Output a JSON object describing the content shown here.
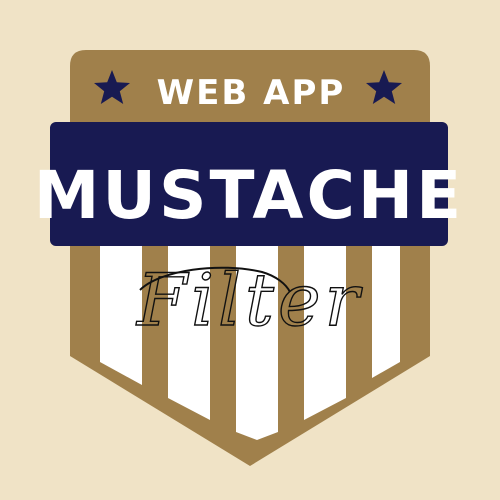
{
  "badge": {
    "subtitle": "WEB APP",
    "title": "MUSTACHE",
    "script": "Filter"
  },
  "colors": {
    "background": "#f0e3c6",
    "gold": "#a0804b",
    "navy": "#181a52",
    "stripe_white": "#ffffff",
    "script_ink": "#111111"
  },
  "icons": [
    "star-icon",
    "star-icon"
  ]
}
